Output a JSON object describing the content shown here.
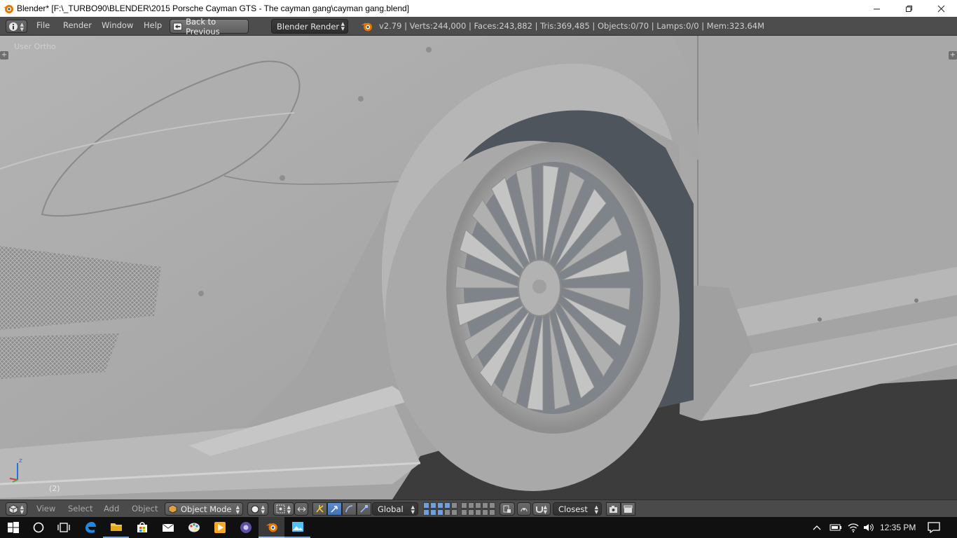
{
  "window": {
    "title": "Blender* [F:\\_TURBO90\\BLENDER\\2015 Porsche Cayman GTS - The cayman gang\\cayman gang.blend]",
    "controls": [
      "minimize",
      "restore",
      "close"
    ]
  },
  "info_header": {
    "menus": [
      "File",
      "Render",
      "Window",
      "Help"
    ],
    "back_button": "Back to Previous",
    "render_engine": "Blender Render",
    "stats": "v2.79 | Verts:244,000 | Faces:243,882 | Tris:369,485 | Objects:0/70 | Lamps:0/0 | Mem:323.64M"
  },
  "viewport": {
    "view_label": "User Ortho",
    "frame_label": "(2)",
    "axis_z_label": "z",
    "axis_colors": {
      "x": "#d23c3c",
      "y": "#3cb43c",
      "z": "#2f6fd6"
    }
  },
  "view_footer": {
    "menus": [
      "View",
      "Select",
      "Add",
      "Object"
    ],
    "mode": "Object Mode",
    "orientation": "Global",
    "snap_target": "Closest"
  },
  "taskbar": {
    "time": "12:35 PM",
    "apps": [
      "start-icon",
      "cortana-icon",
      "task-view-icon",
      "edge-icon",
      "file-explorer-icon",
      "store-icon",
      "mail-icon",
      "paint-icon",
      "media-player-icon",
      "browser-icon",
      "blender-icon",
      "photos-icon"
    ]
  },
  "colors": {
    "header_bg": "#4d4d4d",
    "viewport_bg": "#9a9a9a",
    "accent_blue": "#5680c2",
    "taskbar_bg": "#101010"
  }
}
